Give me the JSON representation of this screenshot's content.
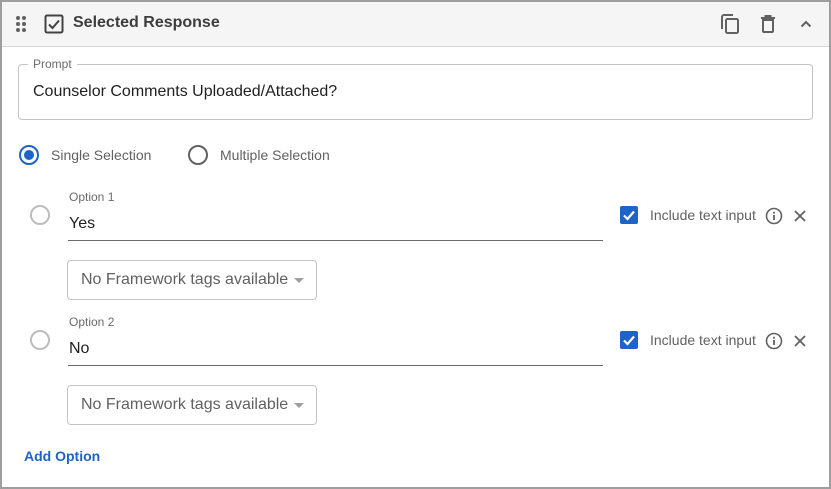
{
  "header": {
    "title": "Selected Response",
    "icons": [
      "drag-handle-icon",
      "checkbox-icon",
      "copy-icon",
      "delete-icon",
      "chevron-up-icon"
    ]
  },
  "prompt": {
    "label": "Prompt",
    "value": "Counselor Comments Uploaded/Attached?"
  },
  "selection_mode": {
    "single_label": "Single Selection",
    "multiple_label": "Multiple Selection",
    "selected": "single"
  },
  "options": [
    {
      "label": "Option 1",
      "value": "Yes",
      "include_text_input_label": "Include text input",
      "include_text_input_checked": true,
      "framework_tags": "No Framework tags available"
    },
    {
      "label": "Option 2",
      "value": "No",
      "include_text_input_label": "Include text input",
      "include_text_input_checked": true,
      "framework_tags": "No Framework tags available"
    }
  ],
  "add_option_label": "Add Option",
  "colors": {
    "accent": "#1e63c8",
    "header_bg": "#f5f5f5",
    "border": "#9e9e9e"
  }
}
